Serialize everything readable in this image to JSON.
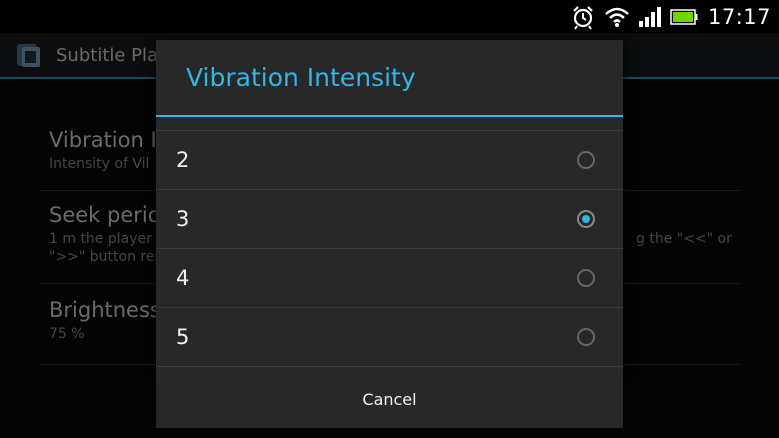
{
  "status_bar": {
    "time": "17:17",
    "icons": [
      "alarm-icon",
      "wifi-icon",
      "signal-icon",
      "battery-icon"
    ]
  },
  "app": {
    "title": "Subtitle Pla",
    "preferences": [
      {
        "title": "Vibration In",
        "summary": "Intensity of Vil"
      },
      {
        "title": "Seek perioc",
        "summary_line1": "1 m the player",
        "summary_line1_tail": "g the \"<<\" or",
        "summary_line2": "\">>\" button res"
      },
      {
        "title": "Brightness",
        "summary": "75 %"
      }
    ]
  },
  "dialog": {
    "title": "Vibration Intensity",
    "options": [
      {
        "label": "2",
        "checked": false
      },
      {
        "label": "3",
        "checked": true
      },
      {
        "label": "4",
        "checked": false
      },
      {
        "label": "5",
        "checked": false
      }
    ],
    "cancel_label": "Cancel"
  },
  "colors": {
    "accent": "#33b5e5",
    "dialog_bg": "#282828",
    "divider": "#3a3a3a"
  }
}
